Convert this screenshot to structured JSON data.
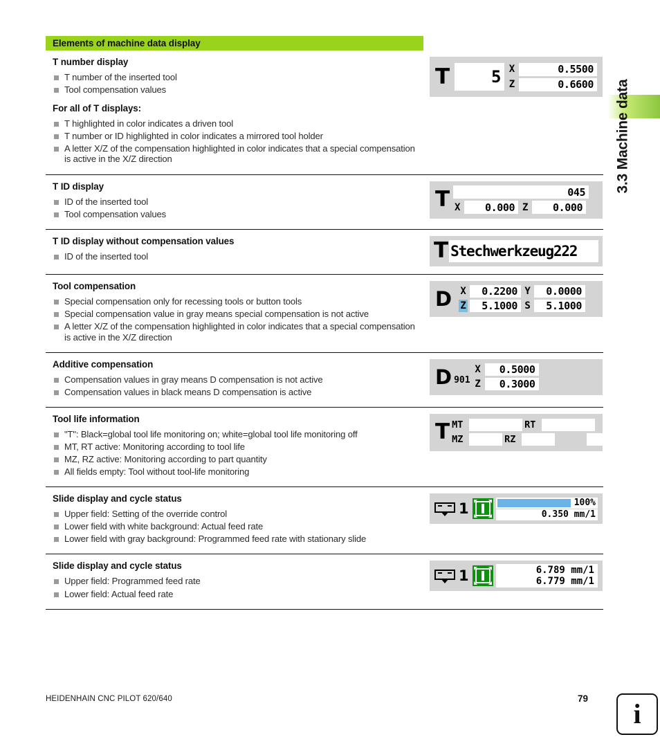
{
  "side": {
    "chapter_title": "3.3 Machine data"
  },
  "header": {
    "title": "Elements of machine data display"
  },
  "sections": [
    {
      "title": "T number display",
      "bullets": [
        "T number of the inserted tool",
        "Tool compensation values"
      ],
      "subtitle": "For all of T displays:",
      "sub_bullets": [
        "T highlighted in color indicates a driven tool",
        "T number or ID highlighted in color indicates a mirrored tool holder",
        "A letter X/Z of the compensation highlighted in color indicates that a special compensation is active in the X/Z direction"
      ],
      "panel": {
        "label": "T",
        "t_number": "5",
        "axis_x": "X",
        "value_x": "0.5500",
        "axis_z": "Z",
        "value_z": "0.6600"
      }
    },
    {
      "title": "T ID display",
      "bullets": [
        "ID of the inserted tool",
        "Tool compensation values"
      ],
      "panel": {
        "label": "T",
        "id": "045",
        "axis_x": "X",
        "value_x": "0.000",
        "axis_z": "Z",
        "value_z": "0.000"
      }
    },
    {
      "title": "T ID display without compensation values",
      "bullets": [
        "ID of the inserted tool"
      ],
      "panel": {
        "label": "T",
        "id": "Stechwerkzeug222"
      }
    },
    {
      "title": "Tool compensation",
      "bullets": [
        "Special compensation only for recessing tools or button tools",
        "Special compensation value in gray means special compensation is not active",
        "A letter X/Z of the compensation highlighted in color indicates that a special compensation is active in the X/Z direction"
      ],
      "panel": {
        "label": "D",
        "axis_x": "X",
        "value_x": "0.2200",
        "axis_y": "Y",
        "value_y": "0.0000",
        "axis_z": "Z",
        "value_z": "5.1000",
        "axis_s": "S",
        "value_s": "5.1000",
        "highlight_color": "#7cbde0"
      }
    },
    {
      "title": "Additive compensation",
      "bullets": [
        "Compensation values in gray means D compensation is not active",
        "Compensation values in black means D compensation is active"
      ],
      "panel": {
        "label": "D",
        "subscript": "901",
        "axis_x": "X",
        "value_x": "0.5000",
        "axis_z": "Z",
        "value_z": "0.3000"
      }
    },
    {
      "title": "Tool life information",
      "bullets": [
        "\"T\": Black=global tool life monitoring on; white=global tool life monitoring off",
        "MT, RT active: Monitoring according to tool life",
        "MZ, RZ active: Monitoring according to part quantity",
        "All fields empty: Tool without tool-life monitoring"
      ],
      "panel": {
        "label": "T",
        "mt_label": "MT",
        "mt_value": "",
        "rt_label": "RT",
        "rt_value": "",
        "mz_label": "MZ",
        "mz_value": "",
        "rz_label": "RZ",
        "rz_value": "",
        "extra_value": ""
      }
    },
    {
      "title": "Slide display and cycle status",
      "bullets": [
        "Upper field: Setting of the override control",
        "Lower field with white background: Actual feed rate",
        "Lower field with gray background: Programmed feed rate with stationary slide"
      ],
      "panel": {
        "slide_number": "1",
        "override_percent": "100%",
        "override_fill": 72,
        "feed_value": "0.350 mm/1",
        "cycle_color": "#109010",
        "bar_color": "#69b3e7"
      }
    },
    {
      "title": "Slide display and cycle status",
      "bullets": [
        "Upper field: Programmed feed rate",
        "Lower field: Actual feed rate"
      ],
      "panel": {
        "slide_number": "1",
        "feed_programmed": "6.789 mm/1",
        "feed_actual": "6.779 mm/1",
        "cycle_color": "#109010"
      }
    }
  ],
  "footer": {
    "product": "HEIDENHAIN CNC PILOT 620/640",
    "page": "79",
    "info_glyph": "i"
  }
}
